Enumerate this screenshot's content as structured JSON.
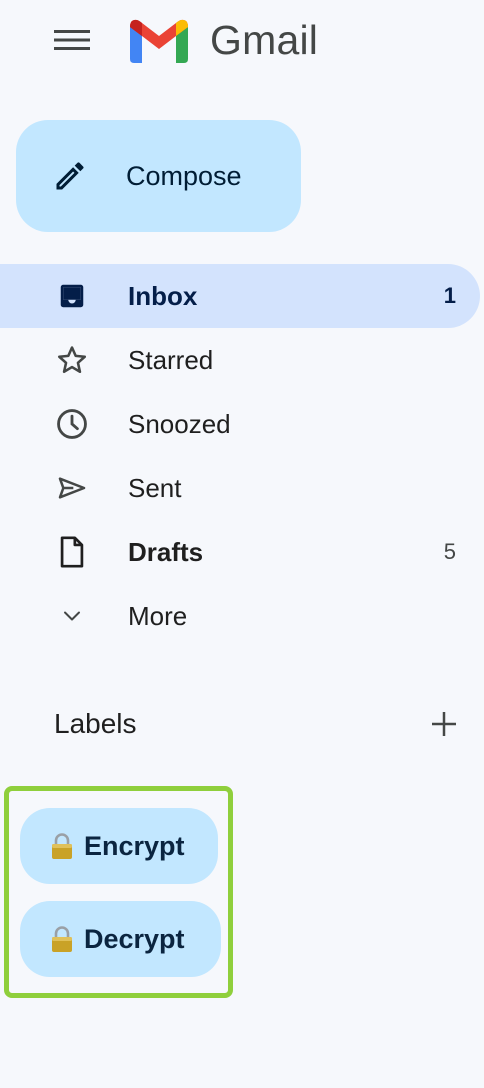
{
  "header": {
    "menu_icon": "hamburger-menu-icon",
    "logo_icon": "gmail-m-logo",
    "app_name": "Gmail"
  },
  "compose": {
    "label": "Compose",
    "icon": "pencil-icon",
    "color": "#c2e7ff"
  },
  "nav": {
    "items": [
      {
        "label": "Inbox",
        "icon": "inbox-icon",
        "count": "1",
        "active": true,
        "bold": true
      },
      {
        "label": "Starred",
        "icon": "star-icon",
        "count": "",
        "active": false,
        "bold": false
      },
      {
        "label": "Snoozed",
        "icon": "clock-icon",
        "count": "",
        "active": false,
        "bold": false
      },
      {
        "label": "Sent",
        "icon": "send-icon",
        "count": "",
        "active": false,
        "bold": false
      },
      {
        "label": "Drafts",
        "icon": "draft-icon",
        "count": "5",
        "active": false,
        "bold": true
      },
      {
        "label": "More",
        "icon": "chevron-down-icon",
        "count": "",
        "active": false,
        "bold": false
      }
    ],
    "active_color": "#d3e3fd"
  },
  "labels": {
    "title": "Labels",
    "add_icon": "plus-icon",
    "items": [
      {
        "label": "Encrypt",
        "icon": "lock-icon"
      },
      {
        "label": "Decrypt",
        "icon": "lock-icon"
      }
    ],
    "highlight_color": "#8fcf3c"
  },
  "colors": {
    "background": "#f6f8fc",
    "accent": "#c2e7ff"
  }
}
